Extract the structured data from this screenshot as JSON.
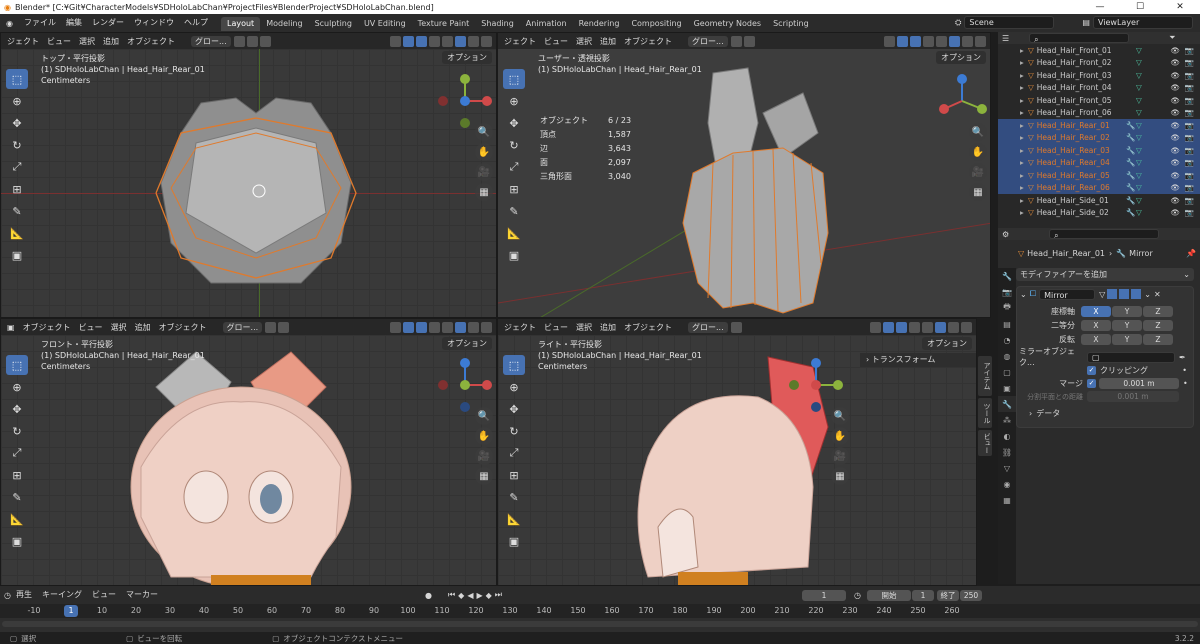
{
  "window": {
    "title": "Blender* [C:¥Git¥CharacterModels¥SDHoloLabChan¥ProjectFiles¥BlenderProject¥SDHoloLabChan.blend]",
    "minimize": "—",
    "maximize": "☐",
    "close": "✕"
  },
  "menu": [
    "ファイル",
    "編集",
    "レンダー",
    "ウィンドウ",
    "ヘルプ"
  ],
  "workspaces": [
    "Layout",
    "Modeling",
    "Sculpting",
    "UV Editing",
    "Texture Paint",
    "Shading",
    "Animation",
    "Rendering",
    "Compositing",
    "Geometry Nodes",
    "Scripting"
  ],
  "active_workspace": "Layout",
  "scene": "Scene",
  "view_layer": "ViewLayer",
  "viewports": {
    "menus": [
      "ジェクト",
      "ビュー",
      "選択",
      "追加",
      "オブジェクト"
    ],
    "menus_full": [
      "オブジェクト",
      "ビュー",
      "選択",
      "追加",
      "オブジェクト"
    ],
    "transform": "グロー...",
    "options": "オプション",
    "topleft": {
      "view": "トップ・平行投影",
      "object": "(1) SDHoloLabChan | Head_Hair_Rear_01",
      "units": "Centimeters"
    },
    "topright": {
      "view": "ユーザー・透視投影",
      "object": "(1) SDHoloLabChan | Head_Hair_Rear_01",
      "stats": [
        [
          "オブジェクト",
          "6 / 23"
        ],
        [
          "頂点",
          "1,587"
        ],
        [
          "辺",
          "3,643"
        ],
        [
          "面",
          "2,097"
        ],
        [
          "三角形面",
          "3,040"
        ]
      ]
    },
    "bottomleft": {
      "view": "フロント・平行投影",
      "object": "(1) SDHoloLabChan | Head_Hair_Rear_01",
      "units": "Centimeters"
    },
    "bottomright": {
      "view": "ライト・平行投影",
      "object": "(1) SDHoloLabChan | Head_Hair_Rear_01",
      "units": "Centimeters",
      "sidebar_panel": "トランスフォーム",
      "sidebar_tabs": [
        "アイテム",
        "ツール",
        "ビュー"
      ]
    }
  },
  "outliner": {
    "rows": [
      {
        "name": "Head_Hair_Front_01",
        "sel": false
      },
      {
        "name": "Head_Hair_Front_02",
        "sel": false
      },
      {
        "name": "Head_Hair_Front_03",
        "sel": false
      },
      {
        "name": "Head_Hair_Front_04",
        "sel": false
      },
      {
        "name": "Head_Hair_Front_05",
        "sel": false
      },
      {
        "name": "Head_Hair_Front_06",
        "sel": false
      },
      {
        "name": "Head_Hair_Rear_01",
        "sel": true
      },
      {
        "name": "Head_Hair_Rear_02",
        "sel": true
      },
      {
        "name": "Head_Hair_Rear_03",
        "sel": true
      },
      {
        "name": "Head_Hair_Rear_04",
        "sel": true
      },
      {
        "name": "Head_Hair_Rear_05",
        "sel": true
      },
      {
        "name": "Head_Hair_Rear_06",
        "sel": true
      },
      {
        "name": "Head_Hair_Side_01",
        "sel": false
      },
      {
        "name": "Head_Hair_Side_02",
        "sel": false
      }
    ]
  },
  "properties": {
    "object": "Head_Hair_Rear_01",
    "modifier_breadcrumb": "Mirror",
    "add_modifier": "モディファイアーを追加",
    "modifier_name": "Mirror",
    "axis_label": "座標軸",
    "bisect_label": "二等分",
    "flip_label": "反転",
    "axes": [
      "X",
      "Y",
      "Z"
    ],
    "mirror_object_label": "ミラーオブジェク...",
    "clipping": "クリッピング",
    "merge_label": "マージ",
    "merge_value": "0.001 m",
    "bisect_distance_label": "分割平面との距離",
    "bisect_distance_value": "0.001 m",
    "data_panel": "データ"
  },
  "timeline": {
    "menus": [
      "再生",
      "キーイング",
      "ビュー",
      "マーカー"
    ],
    "current_frame": "1",
    "start_label": "開始",
    "start": "1",
    "end_label": "終了",
    "end": "250",
    "ticks": [
      "-10",
      "1",
      "10",
      "20",
      "30",
      "40",
      "50",
      "60",
      "70",
      "80",
      "90",
      "100",
      "110",
      "120",
      "130",
      "140",
      "150",
      "160",
      "170",
      "180",
      "190",
      "200",
      "210",
      "220",
      "230",
      "240",
      "250",
      "260"
    ]
  },
  "status": {
    "select": "選択",
    "rotate": "ビューを回転",
    "context": "オブジェクトコンテクストメニュー",
    "version": "3.2.2"
  }
}
